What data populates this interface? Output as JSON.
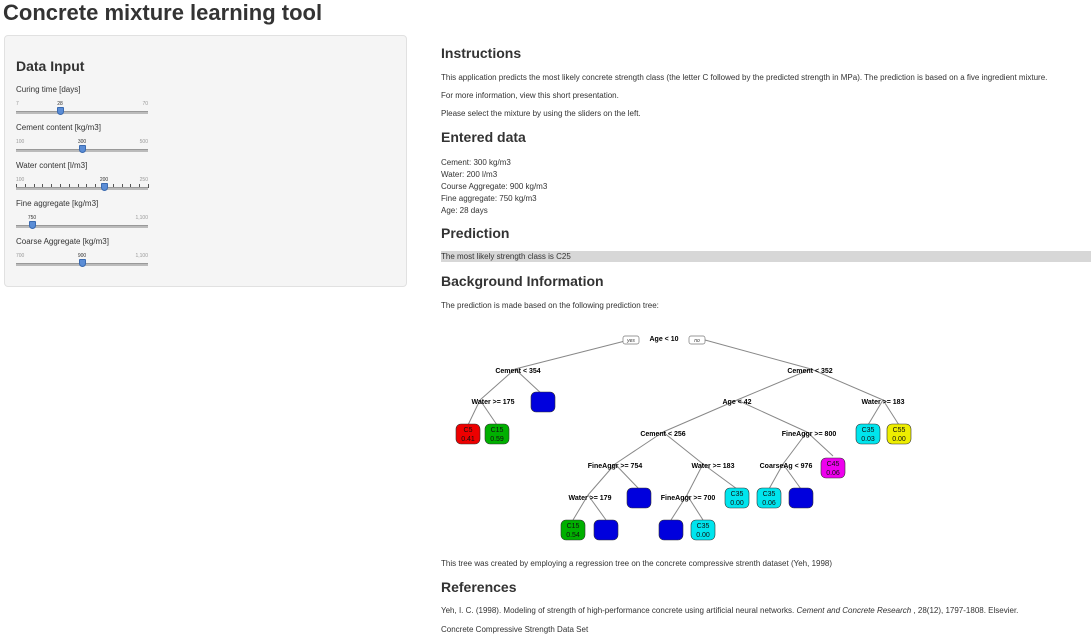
{
  "app": {
    "title": "Concrete mixture learning tool"
  },
  "sidebar": {
    "heading": "Data Input",
    "sliders": [
      {
        "label": "Curing time [days]",
        "min": "7",
        "max": "70",
        "value": "28",
        "fraction": 0.333
      },
      {
        "label": "Cement content [kg/m3]",
        "min": "100",
        "max": "500",
        "value": "300",
        "fraction": 0.5
      },
      {
        "label": "Water content [l/m3]",
        "min": "100",
        "max": "250",
        "value": "200",
        "fraction": 0.667
      },
      {
        "label": "Fine aggregate [kg/m3]",
        "min": "750",
        "max": "1,100",
        "value": "750",
        "fraction": 0.0
      },
      {
        "label": "Coarse Aggregate [kg/m3]",
        "min": "700",
        "max": "1,100",
        "value": "900",
        "fraction": 0.5
      }
    ]
  },
  "main": {
    "instructions_heading": "Instructions",
    "instructions_text": "This application predicts the most likely concrete strength class (the letter C followed by the predicted strength in MPa). The prediction is based on a five ingredient mixture.",
    "info_link": "For more information, view this short presentation.",
    "select_text": "Please select the mixture by using the sliders on the left.",
    "entered_heading": "Entered data",
    "entered_lines": {
      "cement": "Cement: 300 kg/m3",
      "water": "Water: 200 l/m3",
      "coarse": "Course Aggregate: 900 kg/m3",
      "fine": "Fine aggregate: 750 kg/m3",
      "age": "Age: 28 days"
    },
    "prediction_heading": "Prediction",
    "prediction_text": "The most likely strength class is C25",
    "background_heading": "Background Information",
    "background_text": "The prediction is made based on the following prediction tree:",
    "tree_caption": "This tree was created by employing a regression tree on the concrete compressive strenth dataset (Yeh, 1998)",
    "references_heading": "References",
    "reference_text": "Yeh, I. C. (1998). Modeling of strength of high-performance concrete using artificial neural networks.",
    "reference_journal": "Cement and Concrete Research",
    "reference_tail": ", 28(12), 1797-1808. Elsevier.",
    "dataset_link": "Concrete Compressive Strength Data Set"
  },
  "tree": {
    "yes_label": "yes",
    "no_label": "no",
    "splits": [
      "Age < 10",
      "Cement < 354",
      "Cement < 352",
      "Water >= 175",
      "Age < 42",
      "Water >= 183",
      "Cement < 256",
      "FineAggr >= 800",
      "FineAggr >= 754",
      "Water >= 183",
      "CoarseAg < 976",
      "Water >= 179",
      "FineAggr >= 700"
    ],
    "leaves": [
      {
        "line1": "C5",
        "line2": "0.41",
        "color": "#ee0000"
      },
      {
        "line1": "C15",
        "line2": "0.59",
        "color": "#00b000"
      },
      {
        "line1": "",
        "line2": "",
        "color": "#0000dd"
      },
      {
        "line1": "C35",
        "line2": "0.03",
        "color": "#00e5ee"
      },
      {
        "line1": "C55",
        "line2": "0.00",
        "color": "#eeee00"
      },
      {
        "line1": "C45",
        "line2": "0.06",
        "color": "#ee00ee"
      },
      {
        "line1": "C35",
        "line2": "0.06",
        "color": "#00e5ee"
      },
      {
        "line1": "",
        "line2": "",
        "color": "#0000dd"
      },
      {
        "line1": "C35",
        "line2": "0.00",
        "color": "#00e5ee"
      },
      {
        "line1": "",
        "line2": "",
        "color": "#0000dd"
      },
      {
        "line1": "C15",
        "line2": "0.54",
        "color": "#00b000"
      },
      {
        "line1": "",
        "line2": "",
        "color": "#0000dd"
      },
      {
        "line1": "",
        "line2": "",
        "color": "#0000dd"
      },
      {
        "line1": "C35",
        "line2": "0.00",
        "color": "#00e5ee"
      }
    ]
  }
}
